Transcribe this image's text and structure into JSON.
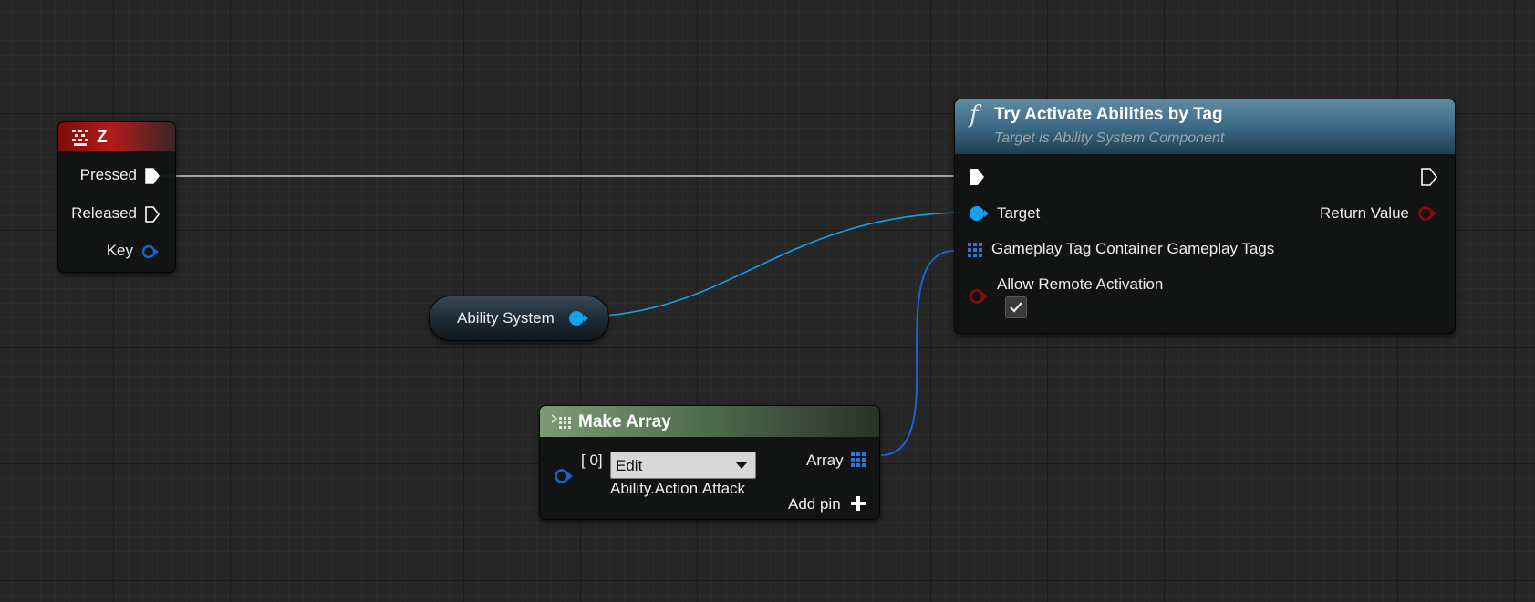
{
  "key_event_node": {
    "title": "Z",
    "pins": {
      "pressed": "Pressed",
      "released": "Released",
      "key": "Key"
    }
  },
  "ability_system_node": {
    "label": "Ability System"
  },
  "try_activate_node": {
    "title": "Try Activate Abilities by Tag",
    "subtitle": "Target is Ability System Component",
    "function_glyph": "f",
    "pins": {
      "target": "Target",
      "return_value": "Return Value",
      "gameplay_tags": "Gameplay Tag Container Gameplay Tags",
      "allow_remote": "Allow Remote Activation"
    },
    "allow_remote_checked": true
  },
  "make_array_node": {
    "title": "Make Array",
    "index_label": "[ 0]",
    "dropdown_value": "Edit",
    "tag_value": "Ability.Action.Attack",
    "array_label": "Array",
    "add_pin_label": "Add pin"
  },
  "colors": {
    "exec_wire": "#cfcfcf",
    "object_pin": "#16a0ec",
    "array_wire": "#1f5fd8",
    "bool_pin": "#8b0b0b",
    "key_struct_pin": "#1d5fd1",
    "event_header": "#a21616",
    "function_header": "#4a7a95",
    "make_array_header": "#5d7a58"
  }
}
